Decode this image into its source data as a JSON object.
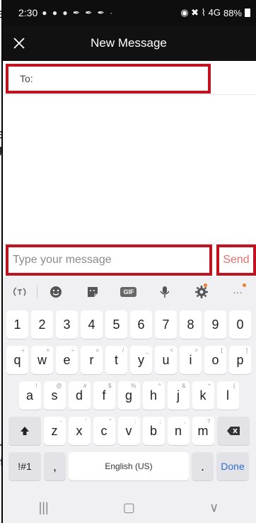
{
  "background_fragments": [
    "e",
    "e",
    "ge",
    "n",
    "ct"
  ],
  "status_bar": {
    "time": "2:30",
    "left_icons": "● ● ● ✒ ✒ ✒ ·",
    "right_icons": "◉ ✖ ⌇ 4G",
    "battery": "88%"
  },
  "header": {
    "title": "New Message"
  },
  "to_field": {
    "label": "To:"
  },
  "compose": {
    "placeholder": "Type your message",
    "send_label": "Send"
  },
  "keyboard": {
    "number_row": [
      "1",
      "2",
      "3",
      "4",
      "5",
      "6",
      "7",
      "8",
      "9",
      "0"
    ],
    "row1": [
      {
        "k": "q",
        "h": "+"
      },
      {
        "k": "w",
        "h": "×"
      },
      {
        "k": "e",
        "h": "÷"
      },
      {
        "k": "r",
        "h": "="
      },
      {
        "k": "t",
        "h": "/"
      },
      {
        "k": "y",
        "h": "_"
      },
      {
        "k": "u",
        "h": "<"
      },
      {
        "k": "i",
        "h": ">"
      },
      {
        "k": "o",
        "h": "["
      },
      {
        "k": "p",
        "h": "]"
      }
    ],
    "row2": [
      {
        "k": "a",
        "h": "!"
      },
      {
        "k": "s",
        "h": "@"
      },
      {
        "k": "d",
        "h": "#"
      },
      {
        "k": "f",
        "h": "$"
      },
      {
        "k": "g",
        "h": "%"
      },
      {
        "k": "h",
        "h": "^"
      },
      {
        "k": "j",
        "h": "&"
      },
      {
        "k": "k",
        "h": "*"
      },
      {
        "k": "l",
        "h": "("
      }
    ],
    "row3": [
      {
        "k": "z",
        "h": "-"
      },
      {
        "k": "x",
        "h": "'"
      },
      {
        "k": "c",
        "h": "\""
      },
      {
        "k": "v",
        "h": ":"
      },
      {
        "k": "b",
        "h": ";"
      },
      {
        "k": "n",
        "h": ","
      },
      {
        "k": "m",
        "h": "?"
      }
    ],
    "symbols_label": "!#1",
    "comma_label": ",",
    "space_label": "English (US)",
    "period_label": ".",
    "done_label": "Done"
  },
  "nav": {
    "recents": "|||",
    "home": "▢",
    "back": "∨"
  },
  "colors": {
    "highlight": "#c1121f",
    "send": "#e8716b",
    "done": "#2a6fd6"
  }
}
